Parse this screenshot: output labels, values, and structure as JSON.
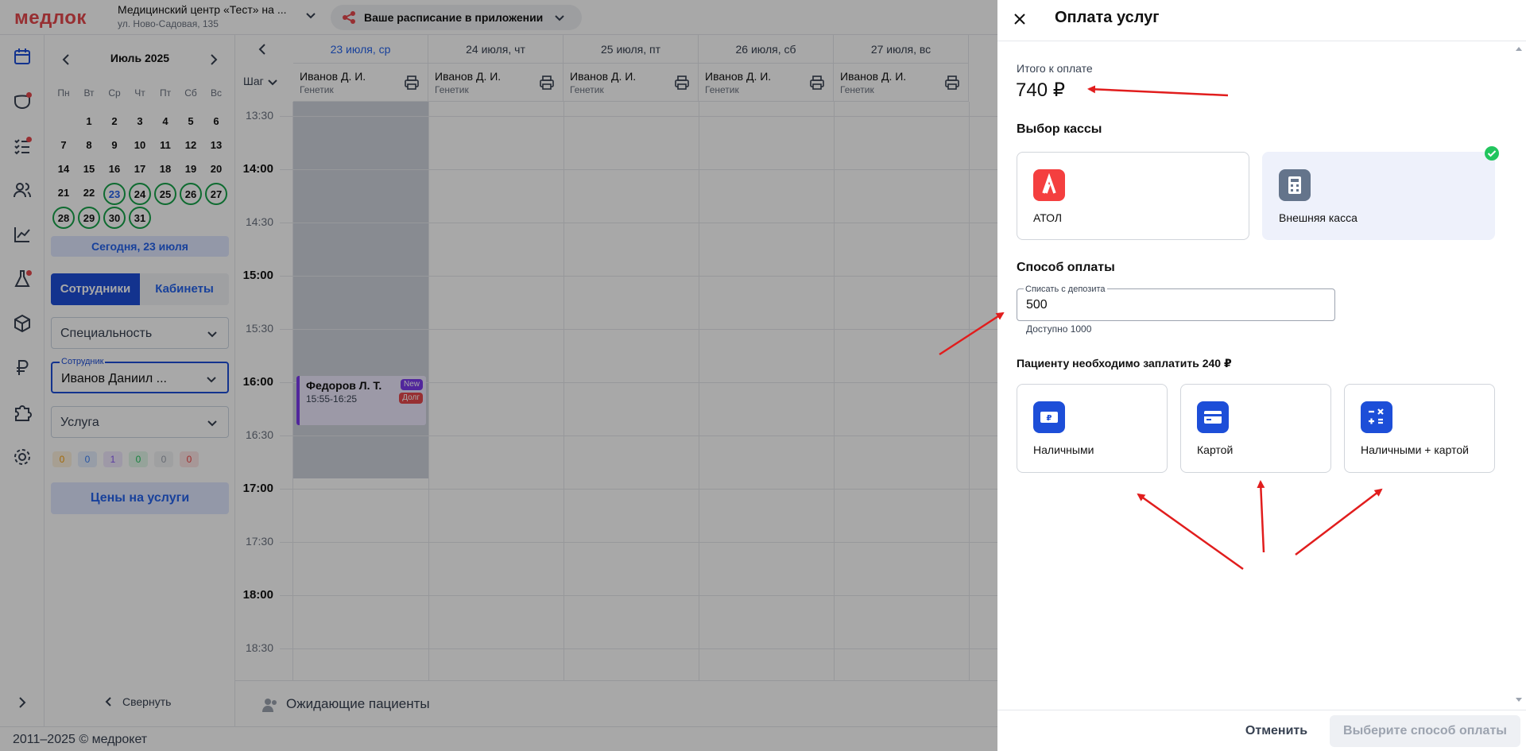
{
  "topbar": {
    "logo": "медлок",
    "clinic_name": "Медицинский центр «Тест» на ...",
    "clinic_address": "ул. Ново-Садовая, 135",
    "app_banner": "Ваше расписание в приложении"
  },
  "calendar": {
    "month": "Июль 2025",
    "weekdays": [
      "Пн",
      "Вт",
      "Ср",
      "Чт",
      "Пт",
      "Сб",
      "Вс"
    ],
    "weeks": [
      [
        "",
        "1",
        "2",
        "3",
        "4",
        "5",
        "6"
      ],
      [
        "7",
        "8",
        "9",
        "10",
        "11",
        "12",
        "13"
      ],
      [
        "14",
        "15",
        "16",
        "17",
        "18",
        "19",
        "20"
      ],
      [
        "21",
        "22",
        "23",
        "24",
        "25",
        "26",
        "27"
      ],
      [
        "28",
        "29",
        "30",
        "31",
        "",
        "",
        ""
      ]
    ],
    "today_button": "Сегодня, 23 июля",
    "tab_staff": "Сотрудники",
    "tab_rooms": "Кабинеты",
    "specialty_placeholder": "Специальность",
    "employee_legend": "Сотрудник",
    "employee_value": "Иванов Даниил ...",
    "service_placeholder": "Услуга",
    "counters": [
      "0",
      "0",
      "1",
      "0",
      "0",
      "0"
    ],
    "counter_colors": [
      "#f59e0b",
      "#3b82f6",
      "#8b5cf6",
      "#22c55e",
      "#9ca3af",
      "#ef4444"
    ],
    "prices_button": "Цены на услуги",
    "collapse_label": "Свернуть"
  },
  "schedule": {
    "step_label": "Шаг",
    "dates": [
      {
        "label": "23 июля, ср",
        "active": true
      },
      {
        "label": "24 июля, чт",
        "active": false
      },
      {
        "label": "25 июля, пт",
        "active": false
      },
      {
        "label": "26 июля, сб",
        "active": false
      },
      {
        "label": "27 июля, вс",
        "active": false
      }
    ],
    "doctor_name": "Иванов Д. И.",
    "doctor_specialty": "Генетик",
    "times": [
      {
        "t": "13:30",
        "hour": false
      },
      {
        "t": "14:00",
        "hour": true
      },
      {
        "t": "14:30",
        "hour": false
      },
      {
        "t": "15:00",
        "hour": true
      },
      {
        "t": "15:30",
        "hour": false
      },
      {
        "t": "16:00",
        "hour": true
      },
      {
        "t": "16:30",
        "hour": false
      },
      {
        "t": "17:00",
        "hour": true
      },
      {
        "t": "17:30",
        "hour": false
      },
      {
        "t": "18:00",
        "hour": true
      },
      {
        "t": "18:30",
        "hour": false
      }
    ],
    "appointment": {
      "patient": "Федоров Л. Т.",
      "time": "15:55-16:25",
      "badge_new": "New",
      "badge_debt": "Долг"
    },
    "waiting_label": "Ожидающие пациенты"
  },
  "footer": {
    "copyright": "2011–2025 © медрокет"
  },
  "payment": {
    "title": "Оплата услуг",
    "total_label": "Итого к оплате",
    "total_value": "740 ₽",
    "register_title": "Выбор кассы",
    "registers": [
      {
        "label": "АТОЛ",
        "color": "#f43f3f",
        "selected": false
      },
      {
        "label": "Внешняя касса",
        "color": "#64748b",
        "selected": true
      }
    ],
    "method_title": "Способ оплаты",
    "deposit_legend": "Списать с депозита",
    "deposit_value": "500",
    "deposit_available": "Доступно 1000",
    "patient_must_pay": "Пациенту необходимо заплатить 240 ₽",
    "methods": [
      {
        "label": "Наличными",
        "icon": "cash-icon"
      },
      {
        "label": "Картой",
        "icon": "card-icon"
      },
      {
        "label": "Наличными + картой",
        "icon": "calculator-icon"
      }
    ],
    "cancel_button": "Отменить",
    "submit_button": "Выберите способ оплаты"
  },
  "colors": {
    "accent": "#1d4ed8",
    "annotation_arrow": "#e11d1d",
    "success": "#22c55e"
  }
}
